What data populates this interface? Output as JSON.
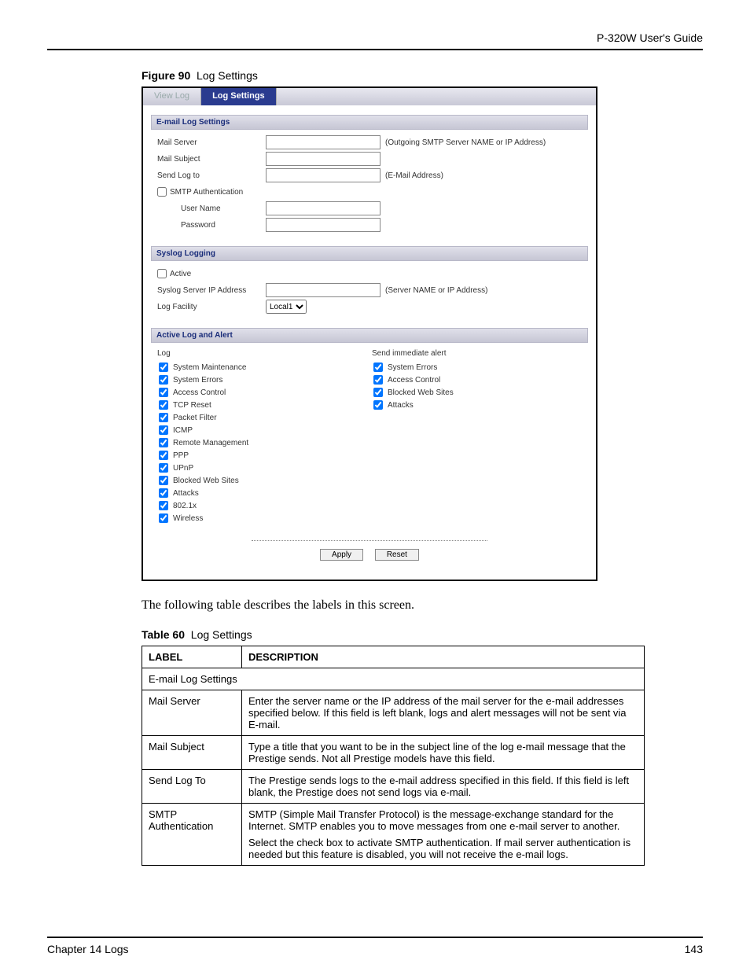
{
  "header": {
    "guide_title": "P-320W User's Guide"
  },
  "figure": {
    "label": "Figure 90",
    "title": "Log Settings"
  },
  "tabs": {
    "view_log": "View Log",
    "log_settings": "Log Settings"
  },
  "email": {
    "section": "E-mail Log Settings",
    "mail_server_label": "Mail Server",
    "mail_server_hint": "(Outgoing SMTP Server NAME or IP Address)",
    "mail_subject_label": "Mail Subject",
    "send_log_to_label": "Send Log to",
    "send_log_to_hint": "(E-Mail Address)",
    "smtp_auth_label": "SMTP Authentication",
    "user_name_label": "User Name",
    "password_label": "Password"
  },
  "syslog": {
    "section": "Syslog Logging",
    "active_label": "Active",
    "server_ip_label": "Syslog Server IP Address",
    "server_ip_hint": "(Server NAME or IP Address)",
    "facility_label": "Log Facility",
    "facility_value": "Local1"
  },
  "active": {
    "section": "Active Log and Alert",
    "log_header": "Log",
    "alert_header": "Send immediate alert",
    "log_items": [
      "System Maintenance",
      "System Errors",
      "Access Control",
      "TCP Reset",
      "Packet Filter",
      "ICMP",
      "Remote Management",
      "PPP",
      "UPnP",
      "Blocked Web Sites",
      "Attacks",
      "802.1x",
      "Wireless"
    ],
    "alert_items": [
      "System Errors",
      "Access Control",
      "Blocked Web Sites",
      "Attacks"
    ]
  },
  "buttons": {
    "apply": "Apply",
    "reset": "Reset"
  },
  "paragraph": "The following table describes the labels in this screen.",
  "table": {
    "label": "Table 60",
    "title": "Log Settings",
    "col_label": "LABEL",
    "col_desc": "DESCRIPTION",
    "rows": [
      {
        "span": true,
        "label": "E-mail Log Settings"
      },
      {
        "label": "Mail Server",
        "desc": "Enter the server name or the IP address of the mail server for the e-mail addresses specified below. If this field is left blank, logs and alert messages will not be sent via E-mail."
      },
      {
        "label": "Mail Subject",
        "desc": "Type a title that you want to be in the subject line of the log e-mail message that the Prestige sends. Not all Prestige models have this field."
      },
      {
        "label": "Send Log To",
        "desc": "The Prestige sends logs to the e-mail address specified in this field. If this field is left blank, the Prestige does not send logs via e-mail."
      },
      {
        "label": "SMTP Authentication",
        "desc": "SMTP (Simple Mail Transfer Protocol) is the message-exchange standard for the Internet. SMTP enables you to move messages from one e-mail server to another.\nSelect the check box to activate SMTP authentication. If mail server authentication is needed but this feature is disabled, you will not receive the e-mail logs."
      }
    ]
  },
  "footer": {
    "chapter": "Chapter 14 Logs",
    "page": "143"
  }
}
